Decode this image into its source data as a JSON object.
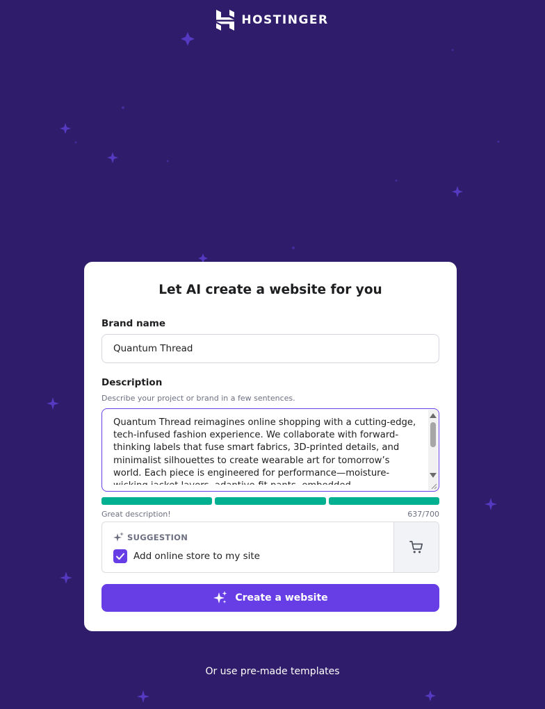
{
  "brand": {
    "logo_text": "HOSTINGER"
  },
  "colors": {
    "background": "#2f1c6a",
    "primary": "#673de6",
    "success": "#00b090",
    "text": "#1d1e20",
    "muted": "#6d7081"
  },
  "card": {
    "title": "Let AI create a website for you",
    "brand_name": {
      "label": "Brand name",
      "value": "Quantum Thread"
    },
    "description": {
      "label": "Description",
      "hint": "Describe your project or brand in a few sentences.",
      "value": "Quantum Thread reimagines online shopping with a cutting-edge, tech-infused fashion experience. We collaborate with forward-thinking labels that fuse smart fabrics, 3D-printed details, and minimalist silhouettes to create wearable art for tomorrow’s world. Each piece is engineered for performance—moisture-wicking jacket layers, adaptive-fit pants, embedded",
      "strength_status": "Great description!",
      "char_count": "637/700",
      "strength_segments_filled": 3,
      "strength_segments_total": 3
    },
    "suggestion": {
      "heading": "SUGGESTION",
      "icon": "sparkle-icon",
      "checkbox_label": "Add online store to my site",
      "checked": true,
      "side_icon": "shopping-cart-icon"
    },
    "create_button": {
      "label": "Create a website",
      "icon": "sparkles-icon"
    }
  },
  "footer": {
    "templates_link": "Or use pre-made templates"
  }
}
